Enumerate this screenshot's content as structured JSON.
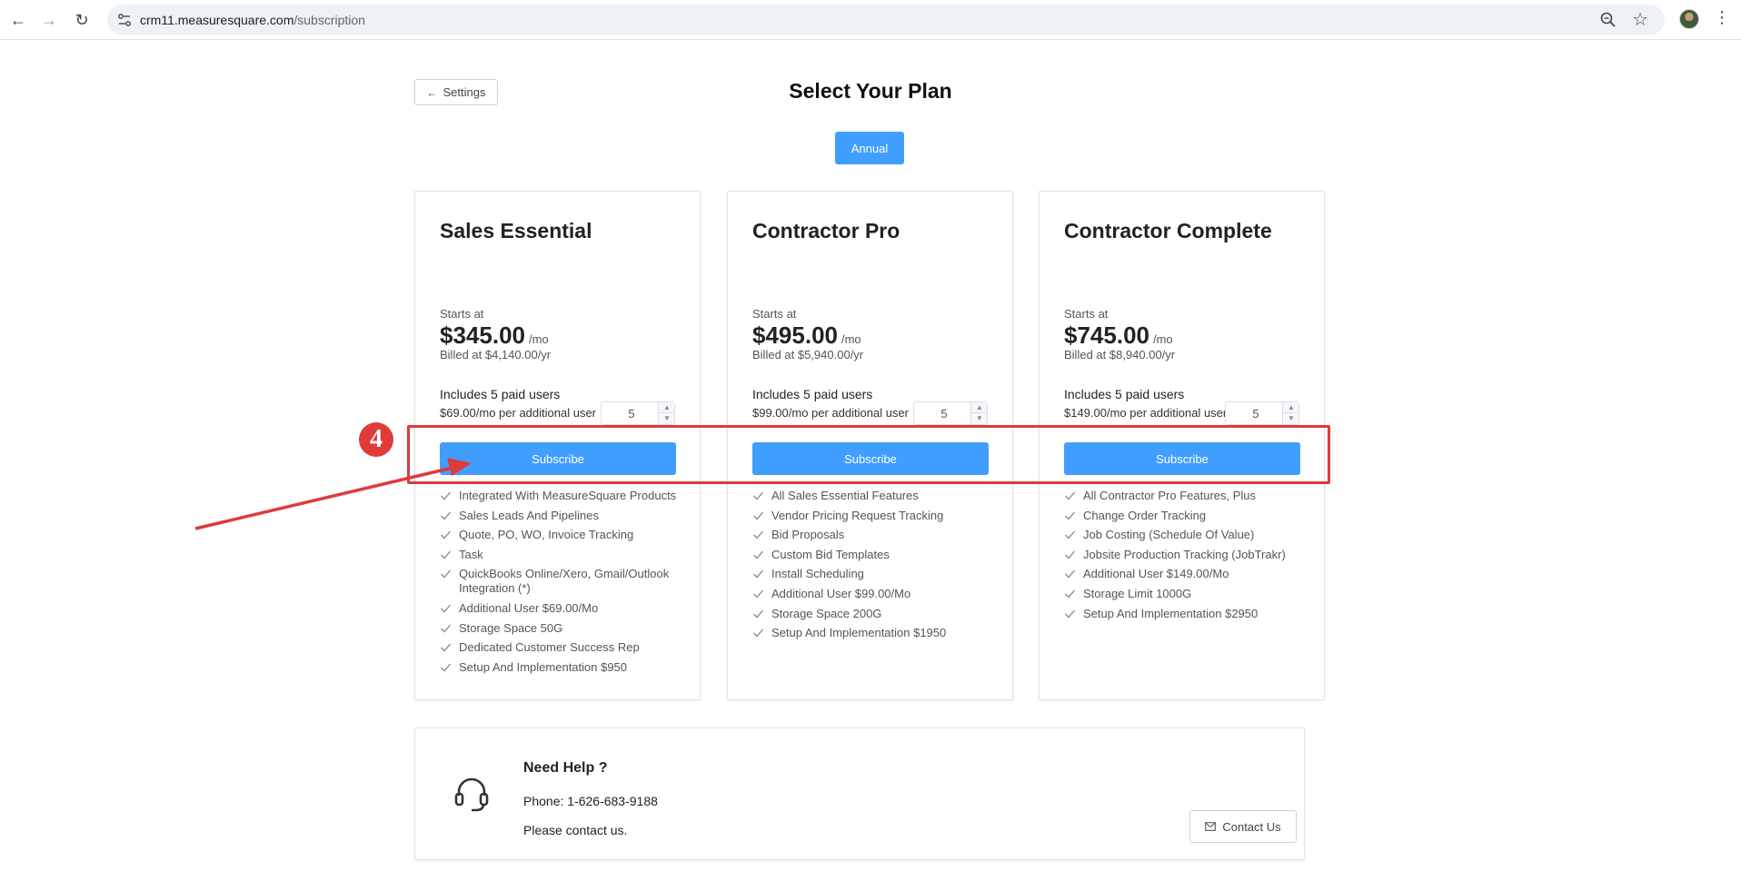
{
  "browser": {
    "url_host": "crm11.measuresquare.com",
    "url_path": "/subscription"
  },
  "page": {
    "back_label": "Settings",
    "title": "Select Your Plan",
    "billing_toggle": "Annual"
  },
  "plans": [
    {
      "name": "Sales Essential",
      "starts_label": "Starts at",
      "price": "$345.00",
      "per": "/mo",
      "billed": "Billed at $4,140.00/yr",
      "includes": "Includes 5 paid users",
      "extra_user": "$69.00/mo per additional user",
      "users_value": "5",
      "subscribe_label": "Subscribe",
      "features": [
        "Integrated With MeasureSquare Products",
        "Sales Leads And Pipelines",
        "Quote, PO, WO, Invoice Tracking",
        "Task",
        "QuickBooks Online/Xero, Gmail/Outlook Integration (*)",
        "Additional User $69.00/Mo",
        "Storage Space 50G",
        "Dedicated Customer Success Rep",
        "Setup And Implementation $950"
      ]
    },
    {
      "name": "Contractor Pro",
      "starts_label": "Starts at",
      "price": "$495.00",
      "per": "/mo",
      "billed": "Billed at $5,940.00/yr",
      "includes": "Includes 5 paid users",
      "extra_user": "$99.00/mo per additional user",
      "users_value": "5",
      "subscribe_label": "Subscribe",
      "features": [
        "All Sales Essential Features",
        "Vendor Pricing Request Tracking",
        "Bid Proposals",
        "Custom Bid Templates",
        "Install Scheduling",
        "Additional User $99.00/Mo",
        "Storage Space 200G",
        "Setup And Implementation $1950"
      ]
    },
    {
      "name": "Contractor Complete",
      "starts_label": "Starts at",
      "price": "$745.00",
      "per": "/mo",
      "billed": "Billed at $8,940.00/yr",
      "includes": "Includes 5 paid users",
      "extra_user": "$149.00/mo per additional user",
      "users_value": "5",
      "subscribe_label": "Subscribe",
      "features": [
        "All Contractor Pro Features, Plus",
        "Change Order Tracking",
        "Job Costing (Schedule Of Value)",
        "Jobsite Production Tracking (JobTrakr)",
        "Additional User $149.00/Mo",
        "Storage Limit 1000G",
        "Setup And Implementation $2950"
      ]
    }
  ],
  "help": {
    "title": "Need Help ?",
    "phone": "Phone: 1-626-683-9188",
    "message": "Please contact us.",
    "contact_label": "Contact Us"
  },
  "annotation": {
    "step_number": "4",
    "color": "#dd3b3b"
  },
  "colors": {
    "primary": "#409eff"
  }
}
